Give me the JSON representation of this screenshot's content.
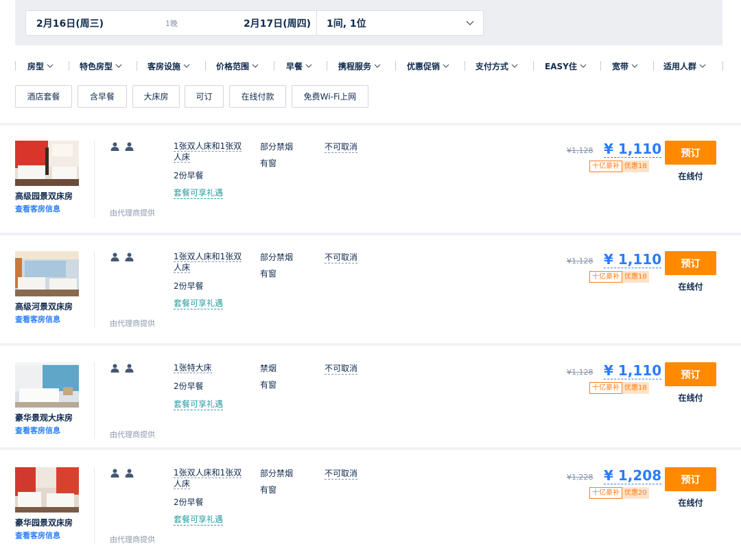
{
  "search": {
    "checkin": "2月16日(周三)",
    "nights": "1晚",
    "checkout": "2月17日(周四)",
    "guests": "1间, 1位"
  },
  "filters": [
    "房型",
    "特色房型",
    "客房设施",
    "价格范围",
    "早餐",
    "携程服务",
    "优惠促销",
    "支付方式",
    "EASY住",
    "宽带",
    "适用人群"
  ],
  "tags": [
    "酒店套餐",
    "含早餐",
    "大床房",
    "可订",
    "在线付款",
    "免费Wi-Fi上网"
  ],
  "rooms": [
    {
      "name": "高级园景双床房",
      "info_link": "查看客房信息",
      "provider": "由代理商提供",
      "bed": "1张双人床和1张双人床",
      "breakfast": "2份早餐",
      "gift": "套餐可享礼遇",
      "smoking": "部分禁烟",
      "window": "有窗",
      "cancel": "不可取消",
      "old_price": "¥1,128",
      "price": "¥ 1,110",
      "badge1": "十亿豪补",
      "badge2": "优惠18",
      "book": "预订",
      "pay": "在线付"
    },
    {
      "name": "高级河景双床房",
      "info_link": "查看客房信息",
      "provider": "由代理商提供",
      "bed": "1张双人床和1张双人床",
      "breakfast": "2份早餐",
      "gift": "套餐可享礼遇",
      "smoking": "部分禁烟",
      "window": "有窗",
      "cancel": "不可取消",
      "old_price": "¥1,128",
      "price": "¥ 1,110",
      "badge1": "十亿豪补",
      "badge2": "优惠18",
      "book": "预订",
      "pay": "在线付"
    },
    {
      "name": "豪华景观大床房",
      "info_link": "查看客房信息",
      "provider": "由代理商提供",
      "bed": "1张特大床",
      "breakfast": "2份早餐",
      "gift": "套餐可享礼遇",
      "smoking": "禁烟",
      "window": "有窗",
      "cancel": "不可取消",
      "old_price": "¥1,128",
      "price": "¥ 1,110",
      "badge1": "十亿豪补",
      "badge2": "优惠18",
      "book": "预订",
      "pay": "在线付"
    },
    {
      "name": "豪华园景双床房",
      "info_link": "查看客房信息",
      "provider": "由代理商提供",
      "bed": "1张双人床和1张双人床",
      "breakfast": "2份早餐",
      "gift": "套餐可享礼遇",
      "smoking": "部分禁烟",
      "window": "有窗",
      "cancel": "不可取消",
      "old_price": "¥1,228",
      "price": "¥ 1,208",
      "badge1": "十亿豪补",
      "badge2": "优惠20",
      "book": "预订",
      "pay": "在线付"
    }
  ],
  "colors": {
    "price_blue": "#287dfa",
    "book_orange": "#ff8a00",
    "badge_orange": "#ff7d13",
    "gift_teal": "#2b9a9f"
  }
}
